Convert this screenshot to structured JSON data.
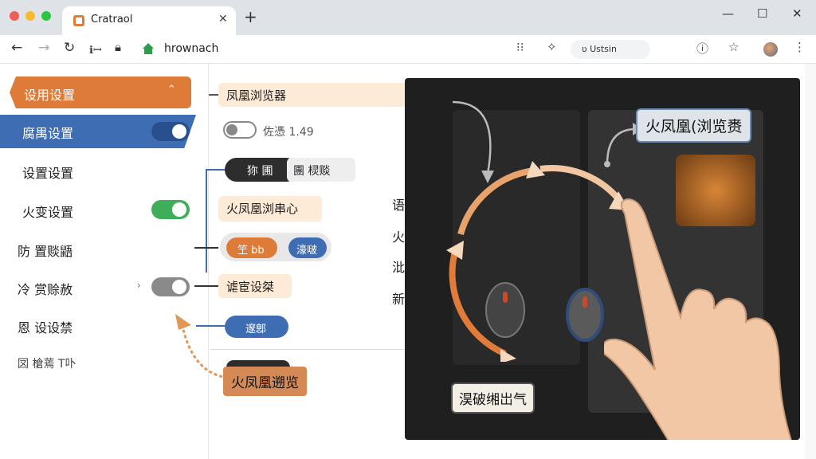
{
  "browser": {
    "tab_title": "Cratraol",
    "url": "hrownach",
    "profile_chip": "ʋ Ustsin",
    "nav_extra": "ℹ︎ꟷ"
  },
  "sidebar": {
    "items": [
      {
        "label": "设用设置",
        "state": "active-orange"
      },
      {
        "label": "腐禺设置",
        "toggle": "on-blue"
      },
      {
        "label": "设置设置"
      },
      {
        "label": "火变设置",
        "toggle": "on-green"
      },
      {
        "label": "防 置赕鼯"
      },
      {
        "label": "冷 赏赊赦",
        "toggle": "off-gray"
      },
      {
        "label": "恩 设设禁"
      },
      {
        "label": "㘝 槍蔫 T卟"
      }
    ]
  },
  "center": {
    "header": "凤凰浏览器",
    "toggle_label": "佐憑 1.49",
    "dark_pill_left": "狝 圃",
    "dark_pill_right": "團 棂赕",
    "section_title": "火凤凰浏串心",
    "btn_orange": "笁 bb",
    "btn_blue": "濠啵",
    "setting_label": "谑宦设桀",
    "btn_blue_small": "邃鄎",
    "orange_callout": "火凤凰遡览",
    "partial_chars": [
      "语",
      "火",
      "沘",
      "新"
    ]
  },
  "overlay": {
    "callout_top": "火凤凰(浏览赉",
    "callout_bottom": "淏破缃岀气"
  },
  "colors": {
    "accent_orange": "#de7b39",
    "accent_blue": "#3f6db3",
    "toggle_green": "#3fae5a",
    "toggle_gray": "#8a8a8a"
  },
  "icons": [
    "back-arrow-icon",
    "forward-arrow-icon",
    "reload-icon",
    "home-icon",
    "extensions-icon",
    "pin-icon",
    "info-icon",
    "star-icon",
    "menu-icon"
  ]
}
